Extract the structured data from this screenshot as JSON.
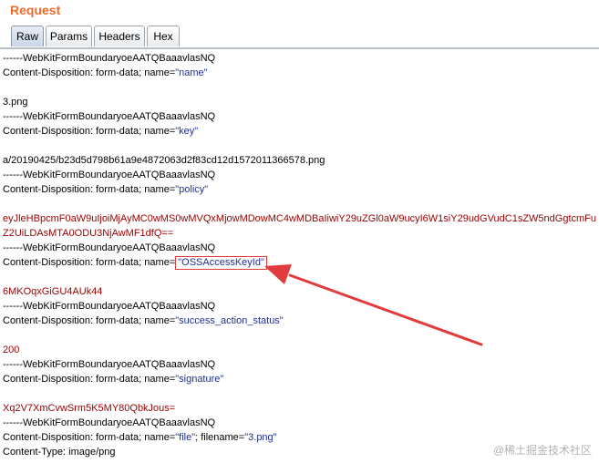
{
  "panel": {
    "title": "Request"
  },
  "tabs": [
    "Raw",
    "Params",
    "Headers",
    "Hex"
  ],
  "body_lines": [
    {
      "type": "boundary",
      "text": "------WebKitFormBoundaryoeAATQBaaavlasNQ"
    },
    {
      "type": "disp",
      "prefix": "Content-Disposition: form-data; name=",
      "name": "\"name\""
    },
    {
      "type": "blank",
      "text": ""
    },
    {
      "type": "plain",
      "text": "3.png"
    },
    {
      "type": "boundary",
      "text": "------WebKitFormBoundaryoeAATQBaaavlasNQ"
    },
    {
      "type": "disp",
      "prefix": "Content-Disposition: form-data; name=",
      "name": "\"key\""
    },
    {
      "type": "blank",
      "text": ""
    },
    {
      "type": "plain",
      "text": "a/20190425/b23d5d798b61a9e4872063d2f83cd12d1572011366578.png"
    },
    {
      "type": "boundary",
      "text": "------WebKitFormBoundaryoeAATQBaaavlasNQ"
    },
    {
      "type": "disp",
      "prefix": "Content-Disposition: form-data; name=",
      "name": "\"policy\""
    },
    {
      "type": "blank",
      "text": ""
    },
    {
      "type": "value",
      "text": "eyJleHBpcmF0aW9uIjoiMjAyMC0wMS0wMVQxMjowMDowMC4wMDBaIiwiY29uZGl0aW9ucyI6W1siY29udGVudC1sZW5ndGgtcmFu"
    },
    {
      "type": "value",
      "text": "Z2UiLDAsMTA0ODU3NjAwMF1dfQ=="
    },
    {
      "type": "boundary",
      "text": "------WebKitFormBoundaryoeAATQBaaavlasNQ"
    },
    {
      "type": "disp_boxed",
      "prefix": "Content-Disposition: form-data; name=",
      "name": "\"OSSAccessKeyId\""
    },
    {
      "type": "blank",
      "text": ""
    },
    {
      "type": "value",
      "text": "6MKOqxGiGU4AUk44"
    },
    {
      "type": "boundary",
      "text": "------WebKitFormBoundaryoeAATQBaaavlasNQ"
    },
    {
      "type": "disp",
      "prefix": "Content-Disposition: form-data; name=",
      "name": "\"success_action_status\""
    },
    {
      "type": "blank",
      "text": ""
    },
    {
      "type": "value",
      "text": "200"
    },
    {
      "type": "boundary",
      "text": "------WebKitFormBoundaryoeAATQBaaavlasNQ"
    },
    {
      "type": "disp",
      "prefix": "Content-Disposition: form-data; name=",
      "name": "\"signature\""
    },
    {
      "type": "blank",
      "text": ""
    },
    {
      "type": "value",
      "text": "Xq2V7XmCvwSrm5K5MY80QbkJous="
    },
    {
      "type": "boundary",
      "text": "------WebKitFormBoundaryoeAATQBaaavlasNQ"
    },
    {
      "type": "disp_file",
      "prefix": "Content-Disposition: form-data; name=",
      "name": "\"file\"",
      "mid": "; filename=",
      "file": "\"3.png\""
    },
    {
      "type": "plain",
      "text": "Content-Type: image/png"
    }
  ],
  "watermark": "@稀土掘金技术社区",
  "colors": {
    "title": "#f06a2b",
    "quoted": "#1f2f8f",
    "value": "#990000",
    "annotation": "#e23b3b"
  }
}
